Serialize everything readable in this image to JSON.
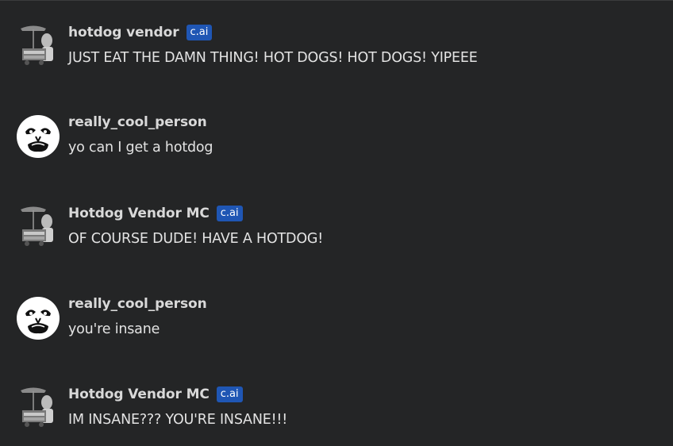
{
  "badge_text": "c.ai",
  "colors": {
    "background": "#242526",
    "badge": "#1f56b4",
    "username": "#d9d9d9",
    "text": "#e3e3e3"
  },
  "messages": [
    {
      "author": "hotdog vendor",
      "is_bot": true,
      "avatar": "hotdog-cart-icon",
      "text": "JUST EAT THE DAMN THING! HOT DOGS! HOT DOGS! YIPEEE"
    },
    {
      "author": "really_cool_person",
      "is_bot": false,
      "avatar": "meme-face-icon",
      "text": "yo can I get a hotdog"
    },
    {
      "author": "Hotdog Vendor MC",
      "is_bot": true,
      "avatar": "hotdog-cart-icon",
      "text": "OF COURSE DUDE! HAVE A HOTDOG!"
    },
    {
      "author": "really_cool_person",
      "is_bot": false,
      "avatar": "meme-face-icon",
      "text": "you're insane"
    },
    {
      "author": "Hotdog Vendor MC",
      "is_bot": true,
      "avatar": "hotdog-cart-icon",
      "text": "IM INSANE??? YOU'RE INSANE!!!"
    }
  ]
}
